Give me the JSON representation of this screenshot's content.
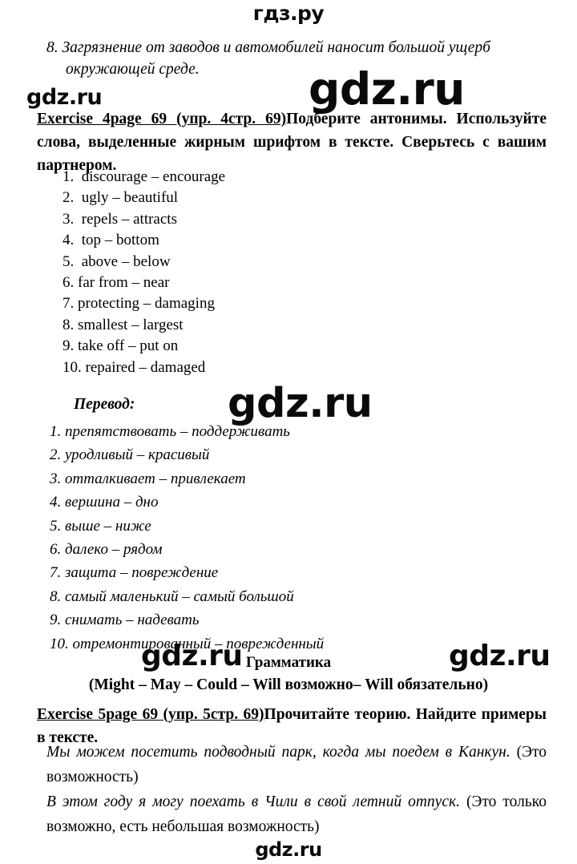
{
  "site": {
    "header_watermark": "гдз.ру",
    "watermark_text": "gdz.ru",
    "watermarks": [
      {
        "name": "watermark-top-large",
        "text": "gdz.ru"
      },
      {
        "name": "watermark-left-small",
        "text": "gdz.ru"
      },
      {
        "name": "watermark-middle",
        "text": "gdz.ru"
      },
      {
        "name": "watermark-grammar-left",
        "text": "gdz.ru"
      },
      {
        "name": "watermark-grammar-right",
        "text": "gdz.ru"
      },
      {
        "name": "watermark-footer",
        "text": "gdz.ru"
      }
    ]
  },
  "top_sentence": {
    "number": "8.",
    "line1": "Загрязнение от заводов и автомобилей наносит большой ущерб",
    "line2": "окружающей среде."
  },
  "exercise4": {
    "link_label": "Exercise 4page 69 (упр. 4стр. 69)",
    "task_text": "Подберите антонимы. Используйте слова, выделенные жирным шрифтом в тексте. Сверьтесь с вашим партнером.",
    "answers": [
      "1.  discourage – encourage",
      "2.  ugly – beautiful",
      "3.  repels – attracts",
      "4.  top – bottom",
      "5.  above – below",
      "6. far from – near",
      "7. protecting – damaging",
      "8. smallest – largest",
      "9. take off – put on",
      "10. repaired – damaged"
    ],
    "translation_heading": "Перевод:",
    "translation_answers": [
      "1. препятствовать – поддерживать",
      "2. уродливый – красивый",
      "3. отталкивает – привлекает",
      "4. вершина – дно",
      "5. выше – ниже",
      "6. далеко – рядом",
      "7. защита – повреждение",
      "8. самый маленький – самый большой",
      "9. снимать – надевать",
      "10. отремонтированный – поврежденный"
    ]
  },
  "grammar": {
    "heading": "Грамматика",
    "modal_line": "(Might – May – Could – Will возможно– Will обязательно)"
  },
  "exercise5": {
    "link_label": "Exercise 5page 69 (упр. 5стр. 69)",
    "task_text": "Прочитайте теорию. Найдите примеры в тексте.",
    "example1_italic": "Мы можем посетить подводный парк, когда мы поедем в Канкун.",
    "example1_note": "(Это возможность)",
    "example2_italic": "В этом году я могу поехать в Чили в свой летний отпуск.",
    "example2_note": "(Это только возможно, есть небольшая возможность)"
  }
}
